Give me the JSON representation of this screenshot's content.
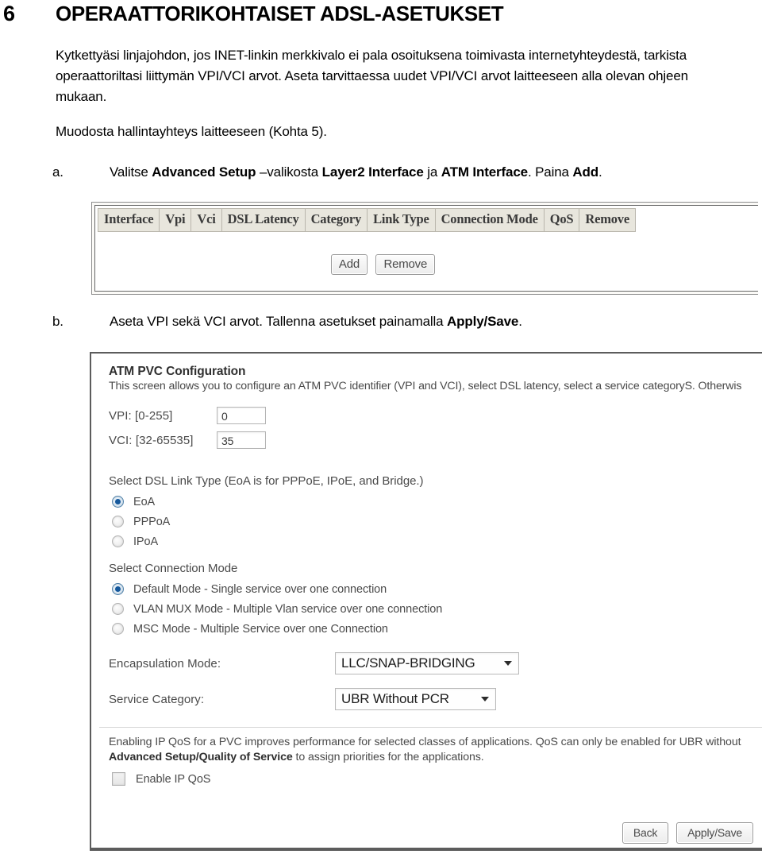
{
  "document": {
    "section_number": "6",
    "section_title": "OPERAATTORIKOHTAISET ADSL-ASETUKSET",
    "intro_paragraph": "Kytkettyäsi linjajohdon, jos INET-linkin merkkivalo ei pala osoituksena toimivasta internetyhteydestä, tarkista operaattoriltasi liittymän VPI/VCI arvot. Aseta tarvittaessa uudet VPI/VCI arvot laitteeseen alla olevan ohjeen mukaan.",
    "management_paragraph": "Muodosta hallintayhteys laitteeseen (Kohta 5)."
  },
  "steps": [
    {
      "letter": "a.",
      "parts": [
        {
          "text": "Valitse ",
          "bold": false
        },
        {
          "text": "Advanced Setup",
          "bold": true
        },
        {
          "text": " –valikosta ",
          "bold": false
        },
        {
          "text": "Layer2 Interface",
          "bold": true
        },
        {
          "text": " ja ",
          "bold": false
        },
        {
          "text": "ATM Interface",
          "bold": true
        },
        {
          "text": ". Paina ",
          "bold": false
        },
        {
          "text": "Add",
          "bold": true
        },
        {
          "text": ".",
          "bold": false
        }
      ]
    },
    {
      "letter": "b.",
      "parts": [
        {
          "text": "Aseta VPI sekä VCI arvot. Tallenna asetukset painamalla ",
          "bold": false
        },
        {
          "text": "Apply/Save",
          "bold": true
        },
        {
          "text": ".",
          "bold": false
        }
      ]
    }
  ],
  "screenshot_atm_interface": {
    "table_headers": [
      "Interface",
      "Vpi",
      "Vci",
      "DSL Latency",
      "Category",
      "Link Type",
      "Connection Mode",
      "QoS",
      "Remove"
    ],
    "rows": [],
    "buttons": [
      {
        "label": "Add"
      },
      {
        "label": "Remove"
      }
    ]
  },
  "screenshot_atm_pvc": {
    "title": "ATM PVC Configuration",
    "description": "This screen allows you to configure an ATM PVC identifier (VPI and VCI), select DSL latency, select a service categoryS. Otherwis",
    "vpi": {
      "label": "VPI: [0-255]",
      "value": "0"
    },
    "vci": {
      "label": "VCI: [32-65535]",
      "value": "35"
    },
    "link_type": {
      "caption": "Select DSL Link Type (EoA is for PPPoE, IPoE, and Bridge.)",
      "options": [
        {
          "label": "EoA",
          "selected": true
        },
        {
          "label": "PPPoA",
          "selected": false
        },
        {
          "label": "IPoA",
          "selected": false
        }
      ]
    },
    "connection_mode": {
      "caption": "Select Connection Mode",
      "options": [
        {
          "label": "Default Mode - Single service over one connection",
          "selected": true
        },
        {
          "label": "VLAN MUX Mode - Multiple Vlan service over one connection",
          "selected": false
        },
        {
          "label": "MSC Mode - Multiple Service over one Connection",
          "selected": false
        }
      ]
    },
    "encapsulation_mode": {
      "label": "Encapsulation Mode:",
      "value": "LLC/SNAP-BRIDGING"
    },
    "service_category": {
      "label": "Service Category:",
      "value": "UBR Without PCR"
    },
    "qos": {
      "note_line1_pre": "Enabling IP QoS for a PVC improves performance for selected classes of applications.  QoS can only be enabled for UBR without",
      "note_line2_bold": "Advanced Setup/Quality of Service",
      "note_line2_post": " to assign priorities for the applications.",
      "checkbox_label": "Enable IP QoS",
      "checkbox_checked": false
    },
    "footer_buttons": [
      {
        "label": "Back"
      },
      {
        "label": "Apply/Save"
      }
    ]
  },
  "colors": {
    "page_background": "#ffffff",
    "text": "#000000",
    "ui_text": "#4a4a4a",
    "table_header_bg": "#e8e6dd",
    "radio_selected": "#15589c",
    "panel_border": "#5c5c5c"
  }
}
